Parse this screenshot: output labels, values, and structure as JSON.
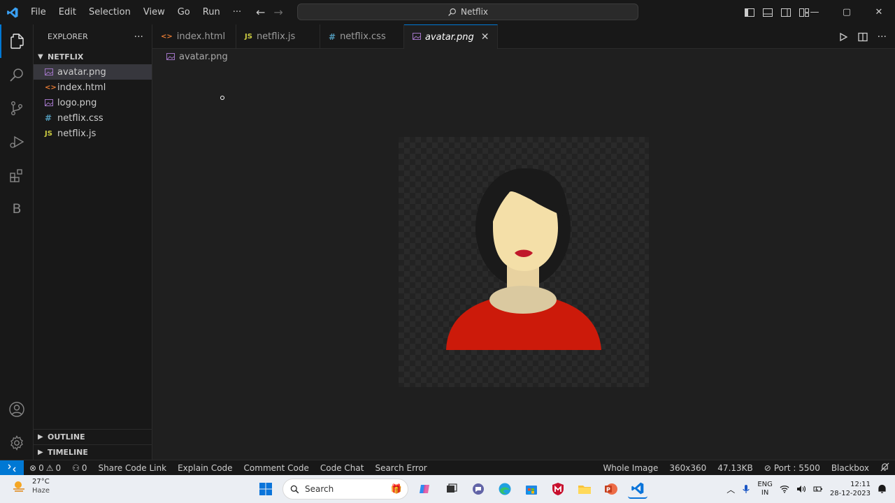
{
  "menu": [
    "File",
    "Edit",
    "Selection",
    "View",
    "Go",
    "Run",
    "···"
  ],
  "search_box": "Netflix",
  "window_controls": {
    "minimize": "—",
    "restore": "▢",
    "close": "✕"
  },
  "sidebar": {
    "title": "EXPLORER",
    "more": "···",
    "folder": "NETFLIX",
    "files": [
      {
        "name": "avatar.png",
        "icon": "image-icon",
        "icon_color": "#a074c4",
        "selected": true
      },
      {
        "name": "index.html",
        "icon": "html-icon",
        "icon_color": "#e37933"
      },
      {
        "name": "logo.png",
        "icon": "image-icon",
        "icon_color": "#a074c4"
      },
      {
        "name": "netflix.css",
        "icon": "css-icon",
        "icon_color": "#519aba"
      },
      {
        "name": "netflix.js",
        "icon": "js-icon",
        "icon_color": "#cbcb41"
      }
    ],
    "outline": "OUTLINE",
    "timeline": "TIMELINE"
  },
  "tabs": [
    {
      "label": "index.html",
      "glyph": "<>",
      "color": "#e37933"
    },
    {
      "label": "netflix.js",
      "glyph": "JS",
      "color": "#cbcb41"
    },
    {
      "label": "netflix.css",
      "glyph": "#",
      "color": "#519aba"
    },
    {
      "label": "avatar.png",
      "glyph": "",
      "color": "#a074c4",
      "active": true
    }
  ],
  "breadcrumb": "avatar.png",
  "activity_bar_letter": "B",
  "status": {
    "errors": "0",
    "warnings": "0",
    "ports": "0",
    "items": [
      "Share Code Link",
      "Explain Code",
      "Comment Code",
      "Code Chat",
      "Search Error"
    ],
    "right": [
      "Whole Image",
      "360x360",
      "47.13KB",
      "Port : 5500",
      "Blackbox"
    ]
  },
  "taskbar": {
    "temperature": "27°C",
    "weather": "Haze",
    "search_placeholder": "Search",
    "lang_top": "ENG",
    "lang_bottom": "IN",
    "time": "12:11",
    "date": "28-12-2023"
  },
  "colors": {
    "accent": "#0078d4",
    "shirt": "#cc1a0a",
    "skin": "#f4dfa8",
    "hair": "#1a1a1a"
  }
}
